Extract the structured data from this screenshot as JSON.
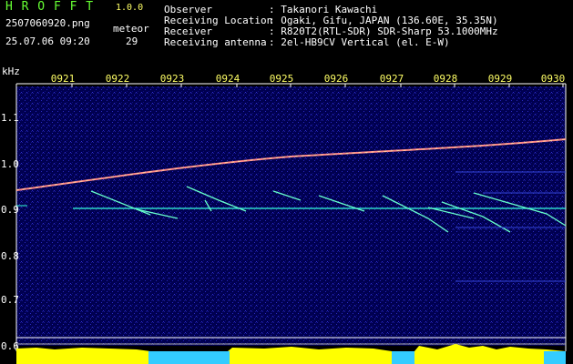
{
  "app": {
    "name": "H R O F F T",
    "version": "1.0.0"
  },
  "file": {
    "name": "2507060920.png",
    "datetime": "25.07.06 09:20"
  },
  "meteor": {
    "label": "meteor",
    "count": "29"
  },
  "info": [
    {
      "key": "Observer",
      "value": ": Takanori Kawachi"
    },
    {
      "key": "Receiving Location",
      "value": ": Ogaki, Gifu, JAPAN (136.60E, 35.35N)"
    },
    {
      "key": "Receiver",
      "value": ": R820T2(RTL-SDR) SDR-Sharp 53.1000MHz"
    },
    {
      "key": "Receiving antenna",
      "value": ": 2el-HB9CV Vertical (el. E-W)"
    }
  ],
  "spectrogram": {
    "unit_label": "kHz",
    "time_ticks": [
      "0921",
      "0922",
      "0923",
      "0924",
      "0925",
      "0926",
      "0927",
      "0928",
      "0929",
      "0930"
    ],
    "freq_ticks": [
      "1.1",
      "1.0",
      "0.9",
      "0.8",
      "0.7",
      "0.6"
    ],
    "freq_range_khz": [
      0.58,
      1.17
    ],
    "colors": {
      "background": "#000055",
      "carrier": "#ff6666",
      "trace": "#66ffcc",
      "axis": "#ffffff",
      "level": "#ffff00",
      "level_base": "#33ccff"
    }
  }
}
